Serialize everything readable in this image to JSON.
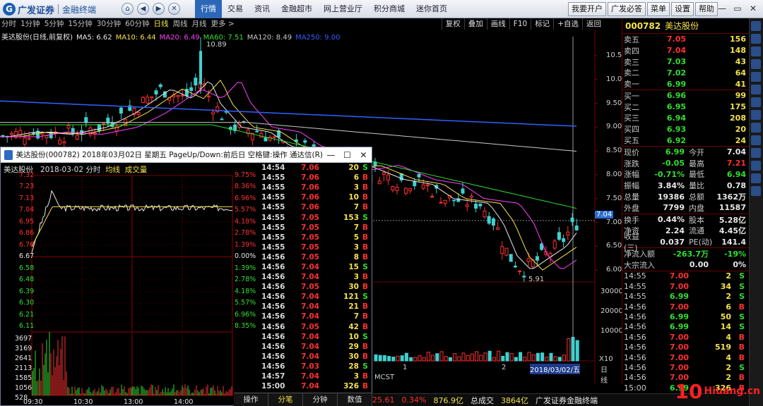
{
  "app": {
    "brand": "广发证券",
    "subtitle": "金融终端"
  },
  "topnav": [
    "行情",
    "交易",
    "资讯",
    "金融超市",
    "网上营业厅",
    "积分商城",
    "迷你首页"
  ],
  "topright": [
    "我要开户",
    "广发必答",
    "菜单",
    "设置",
    "帮助"
  ],
  "periods": [
    "分时",
    "1分钟",
    "5分钟",
    "15分钟",
    "30分钟",
    "60分钟",
    "日线",
    "周线",
    "月线",
    "更多 >"
  ],
  "period_active": "日线",
  "chart_tools": [
    "复权",
    "叠加",
    "画线",
    "F10",
    "标记",
    "+自选",
    "返回"
  ],
  "ma_legend": [
    {
      "label": "美达股份(日线,前复权)",
      "color": "#e8e8e8"
    },
    {
      "label": "MA5: 6.62",
      "color": "#e8e8e8"
    },
    {
      "label": "MA10: 6.44",
      "color": "#f5e24a"
    },
    {
      "label": "MA20: 6.49",
      "color": "#ff40ff"
    },
    {
      "label": "MA60: 7.51",
      "color": "#30e030"
    },
    {
      "label": "MA120: 8.49",
      "color": "#c8c8c8"
    },
    {
      "label": "MA250: 9.00",
      "color": "#3060ff"
    }
  ],
  "price_axis": [
    "10.50",
    "10.00",
    "9.50",
    "9.00",
    "8.50",
    "8.00",
    "7.50",
    "7.00",
    "6.50",
    "6.00"
  ],
  "volume_axis": [
    "30000",
    "20000",
    "10000"
  ],
  "vol_unit": "X10",
  "chart_notes": {
    "high_label": "10.89",
    "low_label": "5.91",
    "current_price": "7.04",
    "date_tag": "2018/03/02/五",
    "month_1": "1",
    "month_2": "2",
    "indicator": "MCST",
    "bottom_tab": "日线"
  },
  "quote": {
    "code": "000782",
    "name": "美达股份",
    "asks": [
      {
        "label": "卖五",
        "price": "7.05",
        "vol": "156"
      },
      {
        "label": "卖四",
        "price": "7.04",
        "vol": "148"
      },
      {
        "label": "卖三",
        "price": "7.03",
        "vol": "43"
      },
      {
        "label": "卖二",
        "price": "7.02",
        "vol": "64"
      },
      {
        "label": "卖一",
        "price": "6.99",
        "vol": "41"
      }
    ],
    "bids": [
      {
        "label": "买一",
        "price": "6.96",
        "vol": "99"
      },
      {
        "label": "买二",
        "price": "6.95",
        "vol": "175"
      },
      {
        "label": "买三",
        "price": "6.94",
        "vol": "208"
      },
      {
        "label": "买四",
        "price": "6.93",
        "vol": "20"
      },
      {
        "label": "买五",
        "price": "6.92",
        "vol": "24"
      }
    ],
    "stats": [
      {
        "a": "现价",
        "b": "6.99",
        "c": "今开",
        "d": "7.04"
      },
      {
        "a": "涨跌",
        "b": "-0.05",
        "c": "最高",
        "d": "7.21"
      },
      {
        "a": "涨幅",
        "b": "-0.71%",
        "c": "最低",
        "d": "6.94"
      },
      {
        "a": "振幅",
        "b": "3.84%",
        "c": "量比",
        "d": "0.78"
      },
      {
        "a": "总量",
        "b": "19386",
        "c": "总额",
        "d": "1362万"
      },
      {
        "a": "外盘",
        "b": "7799",
        "c": "内盘",
        "d": "11587"
      }
    ],
    "stats2": [
      {
        "a": "换手",
        "b": "0.44%",
        "c": "股本",
        "d": "5.28亿"
      },
      {
        "a": "净资",
        "b": "2.24",
        "c": "流通",
        "d": "4.45亿"
      },
      {
        "a": "收益(三)",
        "b": "0.037",
        "c": "PE(动)",
        "d": "141.4"
      }
    ],
    "flow": [
      {
        "a": "净流入额",
        "b": "-263.7万",
        "c": "-19%"
      },
      {
        "a": "大宗流入",
        "b": "0.00",
        "c": "0%"
      }
    ],
    "trades": [
      {
        "t": "14:55",
        "p": "7.00",
        "v": "2",
        "f": "S"
      },
      {
        "t": "14:55",
        "p": "7.00",
        "v": "34",
        "f": "S"
      },
      {
        "t": "14:55",
        "p": "6.99",
        "v": "2",
        "f": "S"
      },
      {
        "t": "14:56",
        "p": "7.00",
        "v": "6",
        "f": "B"
      },
      {
        "t": "14:56",
        "p": "6.99",
        "v": "50",
        "f": "S"
      },
      {
        "t": "14:56",
        "p": "6.99",
        "v": "14",
        "f": "S"
      },
      {
        "t": "14:56",
        "p": "7.00",
        "v": "4",
        "f": "B"
      },
      {
        "t": "14:56",
        "p": "7.00",
        "v": "519",
        "f": "B"
      },
      {
        "t": "14:56",
        "p": "7.00",
        "v": "4",
        "f": "B"
      },
      {
        "t": "14:56",
        "p": "7.00",
        "v": "2",
        "f": "S"
      },
      {
        "t": "14:56",
        "p": "7.00",
        "v": "2",
        "f": "B"
      },
      {
        "t": "15:00",
        "p": "6.99",
        "v": "326",
        "f": "B"
      }
    ]
  },
  "popup": {
    "title": "美达股份(000782) 2018年03月02日 星期五 PageUp/Down:前后日 空格键:操作 通达信(R)",
    "head_name": "美达股份",
    "head_date": "2018-03-02 分时",
    "head_avg": "均线",
    "head_vol": "成交量",
    "price_labels": [
      "7.32",
      "7.23",
      "7.13",
      "7.04",
      "6.95",
      "6.86",
      "6.76",
      "6.67",
      "6.58",
      "6.48",
      "6.39",
      "6.30",
      "6.21",
      "6.11"
    ],
    "pct_labels": [
      "9.75%",
      "8.36%",
      "6.96%",
      "5.57%",
      "4.18%",
      "2.78%",
      "1.39%",
      "0.00%",
      "1.39%",
      "2.78%",
      "4.18%",
      "5.57%",
      "6.96%",
      "8.35%"
    ],
    "vol_labels": [
      "3697",
      "3169",
      "2641",
      "2113",
      "1585",
      "1056",
      "528"
    ],
    "time_labels": [
      "09:30",
      "10:30",
      "13:00",
      "14:00"
    ],
    "ticks": [
      {
        "t": "14:54",
        "p": "7.06",
        "v": "20",
        "f": "S"
      },
      {
        "t": "14:55",
        "p": "7.06",
        "v": "6",
        "f": "B"
      },
      {
        "t": "14:55",
        "p": "7.06",
        "v": "3",
        "f": "B"
      },
      {
        "t": "14:55",
        "p": "7.06",
        "v": "10",
        "f": "B"
      },
      {
        "t": "14:55",
        "p": "7.06",
        "v": "7",
        "f": "B"
      },
      {
        "t": "14:55",
        "p": "7.05",
        "v": "153",
        "f": "S"
      },
      {
        "t": "14:55",
        "p": "7.05",
        "v": "7",
        "f": "B"
      },
      {
        "t": "14:55",
        "p": "7.05",
        "v": "5",
        "f": "B"
      },
      {
        "t": "14:55",
        "p": "7.05",
        "v": "3",
        "f": "B"
      },
      {
        "t": "14:56",
        "p": "7.05",
        "v": "8",
        "f": "B"
      },
      {
        "t": "14:56",
        "p": "7.04",
        "v": "15",
        "f": "S"
      },
      {
        "t": "14:56",
        "p": "7.04",
        "v": "3",
        "f": "B"
      },
      {
        "t": "14:56",
        "p": "7.05",
        "v": "30",
        "f": "B"
      },
      {
        "t": "14:56",
        "p": "7.04",
        "v": "121",
        "f": "S"
      },
      {
        "t": "14:56",
        "p": "7.04",
        "v": "21",
        "f": "B"
      },
      {
        "t": "14:56",
        "p": "7.04",
        "v": "7",
        "f": "B"
      },
      {
        "t": "14:56",
        "p": "7.05",
        "v": "42",
        "f": "B"
      },
      {
        "t": "14:56",
        "p": "7.04",
        "v": "10",
        "f": "S"
      },
      {
        "t": "14:56",
        "p": "7.04",
        "v": "29",
        "f": "B"
      },
      {
        "t": "14:56",
        "p": "7.04",
        "v": "30",
        "f": "B"
      },
      {
        "t": "14:56",
        "p": "7.03",
        "v": "28",
        "f": "S"
      },
      {
        "t": "14:57",
        "p": "7.04",
        "v": "3",
        "f": "B"
      },
      {
        "t": "15:00",
        "p": "7.04",
        "v": "326",
        "f": "B"
      }
    ],
    "tabs": [
      "操作",
      "分笔",
      "分钟",
      "数值"
    ]
  },
  "bottombar": [
    {
      "text": "25.61",
      "color": "#ff3030"
    },
    {
      "text": "0.34%",
      "color": "#ff3030"
    },
    {
      "text": "876.9亿",
      "color": "#f5e24a"
    },
    {
      "text": "总成交",
      "color": "#e8e8e8"
    },
    {
      "text": "3864亿",
      "color": "#f5e24a"
    },
    {
      "text": "广发证券金融终端",
      "color": "#e8e8e8"
    }
  ],
  "watermark": {
    "big": "10",
    "site": "Hiuang.cn",
    "name": "拾荒网"
  },
  "colors": {
    "up": "#ff3030",
    "down": "#30e030",
    "accent": "#f5e24a",
    "grid": "#6b0000"
  }
}
